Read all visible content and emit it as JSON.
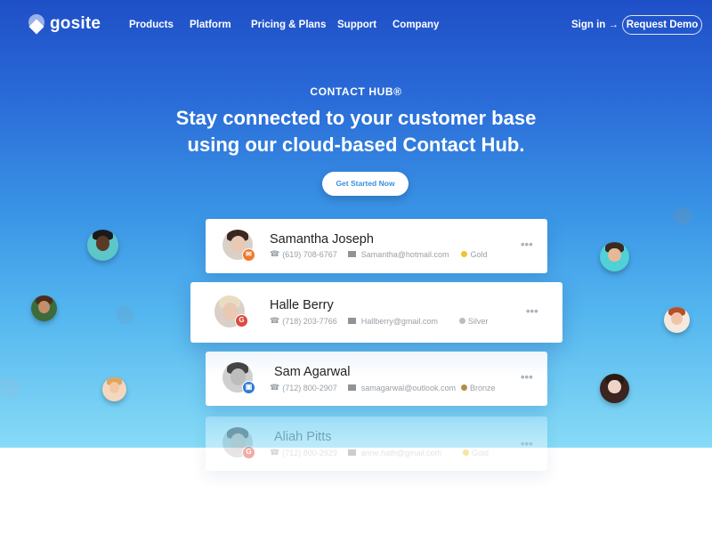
{
  "nav": {
    "logo_text": "gosite",
    "items": [
      "Products",
      "Platform",
      "Pricing & Plans",
      "Support",
      "Company"
    ],
    "sign_in": "Sign in →",
    "request_demo": "Request Demo"
  },
  "hero": {
    "eyebrow": "CONTACT HUB®",
    "headline_line1": "Stay connected to your customer base",
    "headline_line2": "using our cloud-based Contact Hub.",
    "cta": "Get Started Now"
  },
  "contacts": [
    {
      "name": "Samantha Joseph",
      "phone": "(619) 708-6767",
      "email": "Samantha@hotmail.com",
      "tier": "Gold",
      "tier_color": "#f2c230",
      "source": "email",
      "source_color": "#f07a2b",
      "source_glyph": "✉"
    },
    {
      "name": "Halle Berry",
      "phone": "(718) 203-7766",
      "email": "Hallberry@gmail.com",
      "tier": "Silver",
      "tier_color": "#b9bcc0",
      "source": "google",
      "source_color": "#de4a3c",
      "source_glyph": "G"
    },
    {
      "name": "Sam Agarwal",
      "phone": "(712) 800-2907",
      "email": "samagarwal@outlook.com",
      "tier": "Bronze",
      "tier_color": "#b98a4a",
      "source": "outlook",
      "source_color": "#2d7ad6",
      "source_glyph": "▣"
    },
    {
      "name": "Aliah Pitts",
      "phone": "(712) 800-2929",
      "email": "anne.hath@gmail.com",
      "tier": "Gold",
      "tier_color": "#f2c230",
      "source": "google",
      "source_color": "#de4a3c",
      "source_glyph": "G"
    }
  ],
  "icons": {
    "phone": "☎",
    "more": "•••"
  }
}
